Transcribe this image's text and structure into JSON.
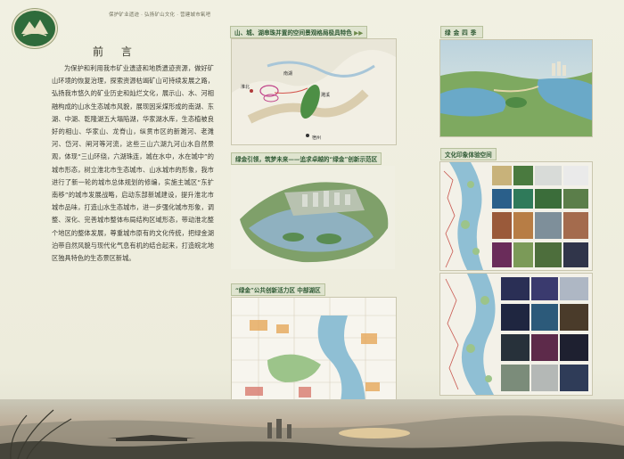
{
  "header": {
    "breadcrumb": "保护矿业遗迹 · 弘扬矿山文化 · 营建城市氧吧"
  },
  "preface": {
    "title": "前 言",
    "body": "为保护和利用我市矿业遗迹和地质遗迹资源，做好矿山环境的恢复治理，探索资源枯竭矿山可持续发展之路，弘扬我市悠久的矿业历史和灿烂文化，展示山、水、河相融构成的山水生态城市风貌，展现因采煤形成的南湖、东湖、中湖、乾隆湖五大塌陷湖，华家湖水库，生态植被良好的相山、华家山、龙脊山，纵贯市区的新濉河、老濉河、岱河、闸河等河流，这些三山六湖九河山水自然景观，体现“三山环绕，六湖珠连，城在水中，水在城中”的城市形态，树立淮北市生态城市、山水城市的形象，我市进行了新一轮的城市总体规划的修编，实施主城区“东扩南移”的城市发展战略，启动东部新城建设，提升淮北市城市品味，打造山水生态城市，进一步强化城市形象，调整、深化、完善城市整体布局结构区域形态，带动淮北整个地区的整体发展，尊重城市原有的文化传统，把绿金湖泊带自然风貌与现代化气息有机的结合起来，打造皖北地区独具特色的生态景区新城。"
  },
  "sections": {
    "s1": "山、城、湖串珠并置的空间景观格局极具特色",
    "s2": "绿金四季",
    "s3": "绿金引领，筑梦未来——追求卓越的“绿金”创新示范区",
    "s4": "文化印象体验空间",
    "s5": "“绿金”公共创新活力区  中部湖区"
  },
  "map1_labels": {
    "main": "淮北",
    "lake": "南湖",
    "city": "宿州",
    "south": "濉溪"
  },
  "colors": {
    "section_title_text": "#2f5a34",
    "section_title_bg": "#dfe4cf",
    "water": "#6aa6c9",
    "green": "#5f9a4b"
  }
}
